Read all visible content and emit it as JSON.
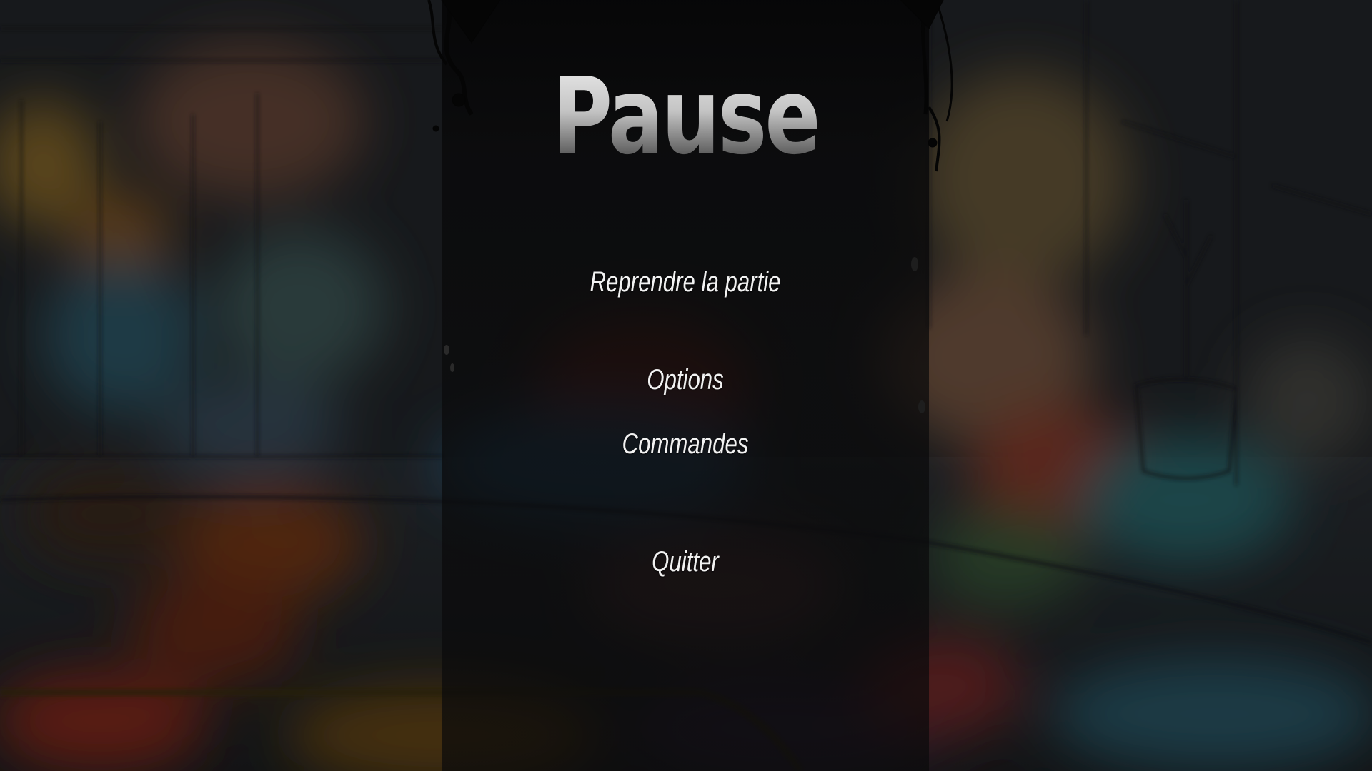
{
  "pause_menu": {
    "title": "Pause",
    "items": [
      {
        "label": "Reprendre la partie"
      },
      {
        "label": "Options"
      },
      {
        "label": "Commandes"
      },
      {
        "label": "Quitter"
      }
    ]
  },
  "colors": {
    "panel": "#0a0a0b",
    "menu_text": "#f2f2f2",
    "title_top": "#eaeaea",
    "title_bottom": "#3a3a3a"
  }
}
